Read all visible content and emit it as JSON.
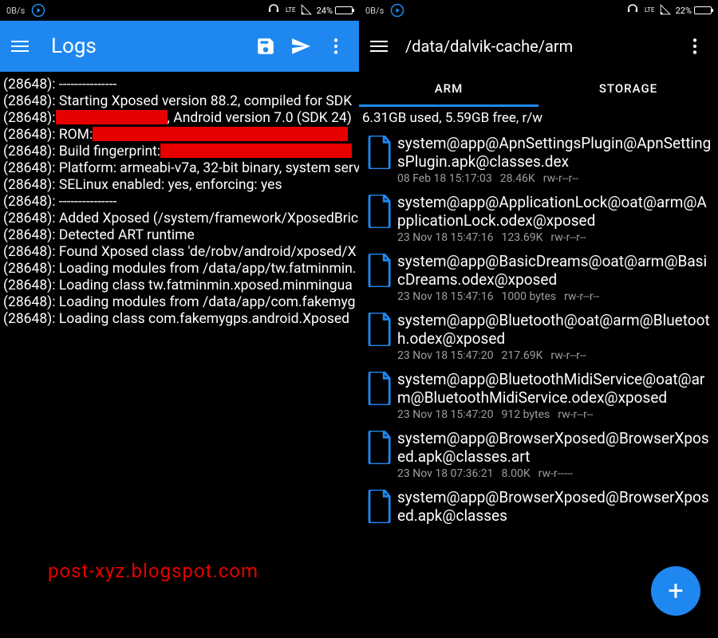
{
  "left": {
    "status": {
      "net_speed": "0B/s",
      "lte": "LTE",
      "battery_pct": "24%",
      "battery_fill": 24
    },
    "title": "Logs",
    "lines": [
      "(28648): ---------------",
      "(28648): Starting Xposed version 88.2, compiled for SDK ",
      "(28648): |REDACT:140|, Android version 7.0 (SDK 24)",
      "(28648): ROM: |REDACT:320|",
      "(28648): Build fingerprint: |REDACT:240|",
      "(28648): Platform: armeabi-v7a, 32-bit binary, system serv",
      "(28648): SELinux enabled: yes, enforcing: yes",
      "(28648): ---------------",
      "(28648): Added Xposed (/system/framework/XposedBric",
      "(28648): Detected ART runtime",
      "(28648): Found Xposed class 'de/robv/android/xposed/X",
      "(28648): Loading modules from /data/app/tw.fatminmin.",
      "(28648):   Loading class tw.fatminmin.xposed.minmingua",
      "(28648): Loading modules from /data/app/com.fakemyg",
      "(28648):   Loading class com.fakemygps.android.Xposed"
    ],
    "watermark": "post-xyz.blogspot.com"
  },
  "right": {
    "status": {
      "net_speed": "0B/s",
      "lte": "LTE",
      "battery_pct": "22%",
      "battery_fill": 22
    },
    "path": "/data/dalvik-cache/arm",
    "tabs": {
      "arm": "ARM",
      "storage": "STORAGE"
    },
    "disk": "6.31GB used, 5.59GB free, r/w",
    "files": [
      {
        "name": "system@app@ApnSettingsPlugin@ApnSettingsPlugin.apk@classes.dex",
        "date": "08 Feb 18 15:17:03",
        "size": "28.46K",
        "perm": "rw-r--r--"
      },
      {
        "name": "system@app@ApplicationLock@oat@arm@ApplicationLock.odex@xposed",
        "date": "23 Nov 18 15:47:16",
        "size": "123.69K",
        "perm": "rw-r--r--"
      },
      {
        "name": "system@app@BasicDreams@oat@arm@BasicDreams.odex@xposed",
        "date": "23 Nov 18 15:47:16",
        "size": "1000 bytes",
        "perm": "rw-r--r--"
      },
      {
        "name": "system@app@Bluetooth@oat@arm@Bluetooth.odex@xposed",
        "date": "23 Nov 18 15:47:20",
        "size": "217.69K",
        "perm": "rw-r--r--"
      },
      {
        "name": "system@app@BluetoothMidiService@oat@arm@BluetoothMidiService.odex@xposed",
        "date": "23 Nov 18 15:47:20",
        "size": "912 bytes",
        "perm": "rw-r--r--"
      },
      {
        "name": "system@app@BrowserXposed@BrowserXposed.apk@classes.art",
        "date": "23 Nov 18 07:36:21",
        "size": "8.00K",
        "perm": "rw-r-----"
      },
      {
        "name": "system@app@BrowserXposed@BrowserXposed.apk@classes",
        "date": "",
        "size": "",
        "perm": ""
      }
    ]
  }
}
